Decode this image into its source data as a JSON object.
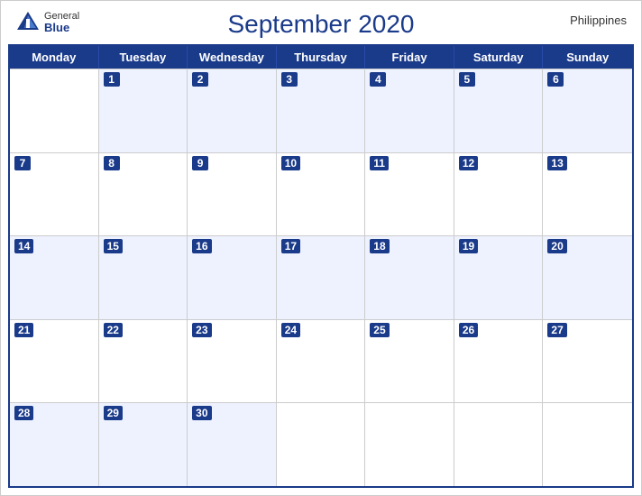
{
  "header": {
    "title": "September 2020",
    "country": "Philippines",
    "logo": {
      "general": "General",
      "blue": "Blue"
    }
  },
  "days": {
    "headers": [
      "Monday",
      "Tuesday",
      "Wednesday",
      "Thursday",
      "Friday",
      "Saturday",
      "Sunday"
    ]
  },
  "weeks": [
    [
      null,
      1,
      2,
      3,
      4,
      5,
      6
    ],
    [
      7,
      8,
      9,
      10,
      11,
      12,
      13
    ],
    [
      14,
      15,
      16,
      17,
      18,
      19,
      20
    ],
    [
      21,
      22,
      23,
      24,
      25,
      26,
      27
    ],
    [
      28,
      29,
      30,
      null,
      null,
      null,
      null
    ]
  ]
}
